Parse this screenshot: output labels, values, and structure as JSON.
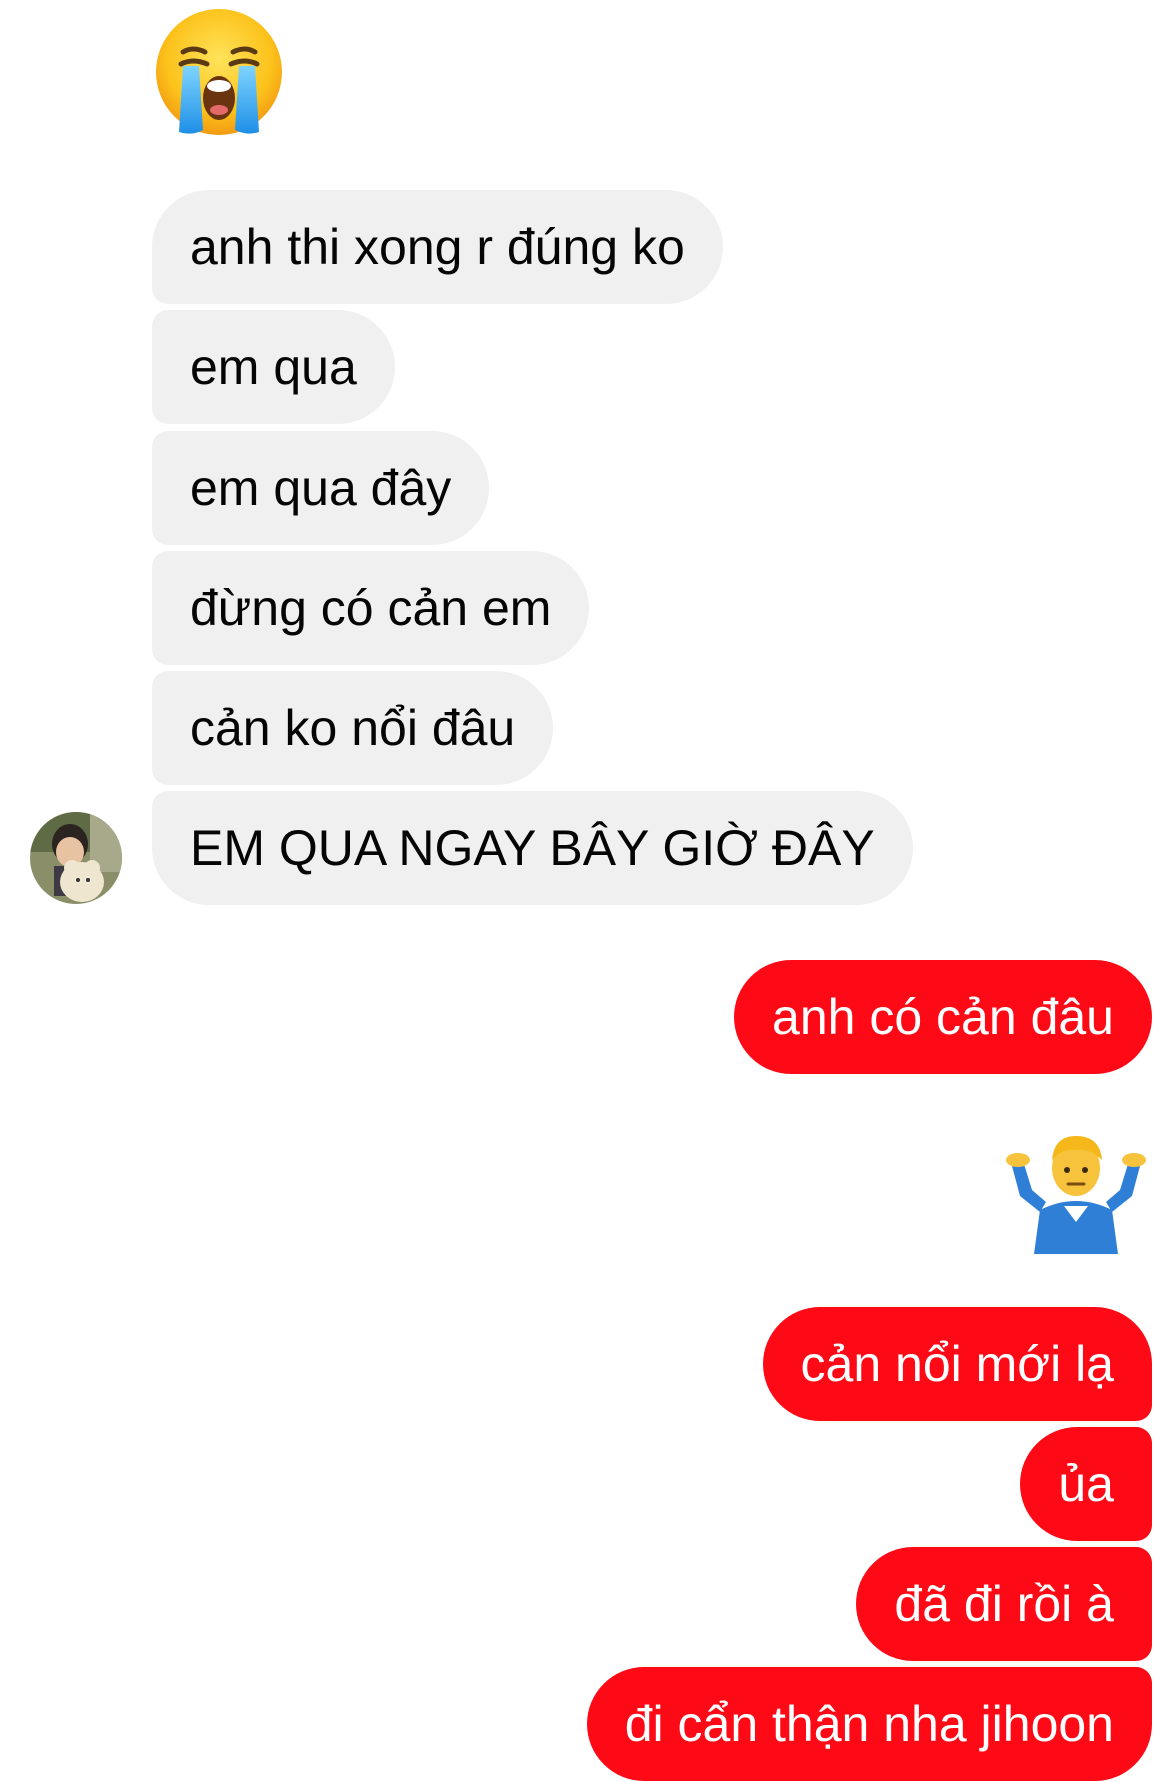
{
  "conversation": {
    "incoming": [
      {
        "text": "anh thi xong r đúng ko"
      },
      {
        "text": "em qua"
      },
      {
        "text": "em qua đây"
      },
      {
        "text": "đừng có cản em"
      },
      {
        "text": "cản ko nổi đâu"
      },
      {
        "text": "EM QUA NGAY BÂY GIỜ ĐÂY"
      }
    ],
    "outgoing": [
      {
        "text": "anh có cản đâu"
      },
      {
        "text": "cản nổi mới lạ"
      },
      {
        "text": "ủa"
      },
      {
        "text": "đã đi rồi à"
      },
      {
        "text": "đi cẩn thận nha jihoon"
      }
    ]
  },
  "emojis": {
    "incoming": "loudly-crying-face-icon",
    "outgoing": "person-shrugging-icon"
  },
  "colors": {
    "incoming_bubble": "#f0f0f0",
    "incoming_text": "#050505",
    "outgoing_bubble": "#fe0a17",
    "outgoing_text": "#ffffff"
  }
}
